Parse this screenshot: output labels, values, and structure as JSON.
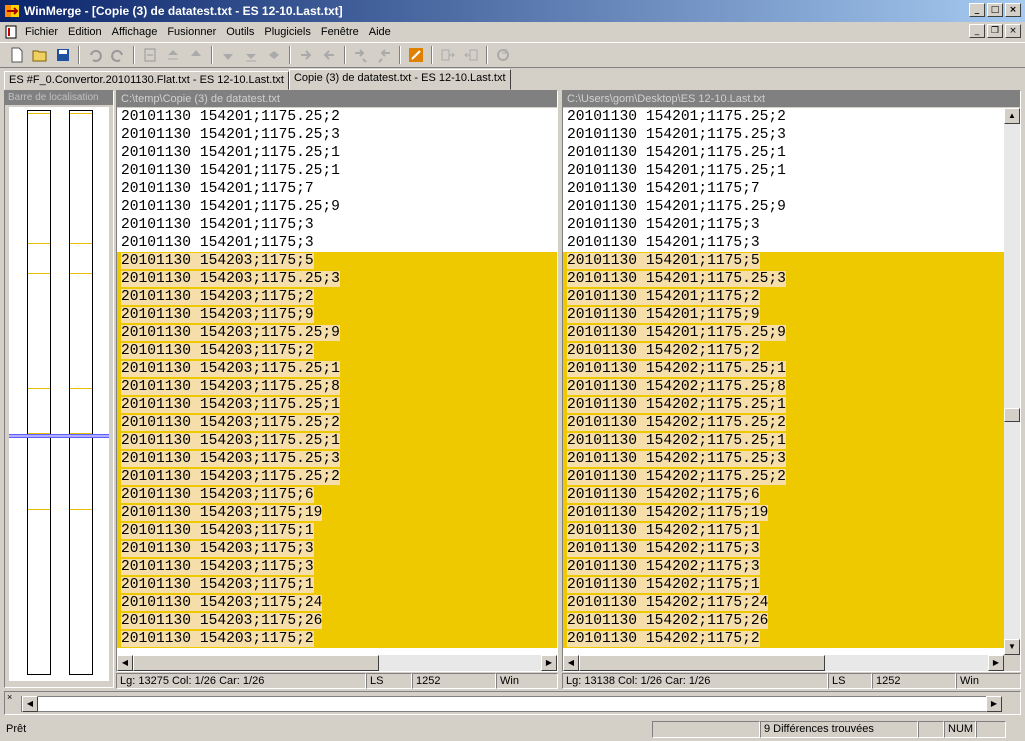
{
  "window": {
    "title": "WinMerge - [Copie (3) de datatest.txt - ES 12-10.Last.txt]"
  },
  "menu": [
    "Fichier",
    "Edition",
    "Affichage",
    "Fusionner",
    "Outils",
    "Plugiciels",
    "Fenêtre",
    "Aide"
  ],
  "tabs": [
    "ES #F_0.Convertor.20101130.Flat.txt - ES 12-10.Last.txt",
    "Copie (3) de datatest.txt - ES 12-10.Last.txt"
  ],
  "location_pane": {
    "title": "Barre de localisation"
  },
  "left_pane": {
    "path": "C:\\temp\\Copie (3) de datatest.txt",
    "same_lines": [
      "20101130 154201;1175.25;2",
      "20101130 154201;1175.25;3",
      "20101130 154201;1175.25;1",
      "20101130 154201;1175.25;1",
      "20101130 154201;1175;7",
      "20101130 154201;1175.25;9",
      "20101130 154201;1175;3",
      "20101130 154201;1175;3"
    ],
    "diff_lines": [
      "20101130 154203;1175;5",
      "20101130 154203;1175.25;3",
      "20101130 154203;1175;2",
      "20101130 154203;1175;9",
      "20101130 154203;1175.25;9",
      "20101130 154203;1175;2",
      "20101130 154203;1175.25;1",
      "20101130 154203;1175.25;8",
      "20101130 154203;1175.25;1",
      "20101130 154203;1175.25;2",
      "20101130 154203;1175.25;1",
      "20101130 154203;1175.25;3",
      "20101130 154203;1175.25;2",
      "20101130 154203;1175;6",
      "20101130 154203;1175;19",
      "20101130 154203;1175;1",
      "20101130 154203;1175;3",
      "20101130 154203;1175;3",
      "20101130 154203;1175;1",
      "20101130 154203;1175;24",
      "20101130 154203;1175;26",
      "20101130 154203;1175;2"
    ],
    "status": {
      "position": "Lg: 13275  Col: 1/26  Car: 1/26",
      "eol": "LS",
      "codepage": "1252",
      "format": "Win"
    }
  },
  "right_pane": {
    "path": "C:\\Users\\gom\\Desktop\\ES 12-10.Last.txt",
    "same_lines": [
      "20101130 154201;1175.25;2",
      "20101130 154201;1175.25;3",
      "20101130 154201;1175.25;1",
      "20101130 154201;1175.25;1",
      "20101130 154201;1175;7",
      "20101130 154201;1175.25;9",
      "20101130 154201;1175;3",
      "20101130 154201;1175;3"
    ],
    "diff_lines": [
      "20101130 154201;1175;5",
      "20101130 154201;1175.25;3",
      "20101130 154201;1175;2",
      "20101130 154201;1175;9",
      "20101130 154201;1175.25;9",
      "20101130 154202;1175;2",
      "20101130 154202;1175.25;1",
      "20101130 154202;1175.25;8",
      "20101130 154202;1175.25;1",
      "20101130 154202;1175.25;2",
      "20101130 154202;1175.25;1",
      "20101130 154202;1175.25;3",
      "20101130 154202;1175.25;2",
      "20101130 154202;1175;6",
      "20101130 154202;1175;19",
      "20101130 154202;1175;1",
      "20101130 154202;1175;3",
      "20101130 154202;1175;3",
      "20101130 154202;1175;1",
      "20101130 154202;1175;24",
      "20101130 154202;1175;26",
      "20101130 154202;1175;2"
    ],
    "status": {
      "position": "Lg: 13138  Col: 1/26  Car: 1/26",
      "eol": "LS",
      "codepage": "1252",
      "format": "Win"
    }
  },
  "statusbar": {
    "ready": "Prêt",
    "differences": "9 Différences trouvées",
    "num": "NUM"
  },
  "colors": {
    "diff_bg": "#efc900",
    "diff_text_bg": "#f5deaa"
  }
}
